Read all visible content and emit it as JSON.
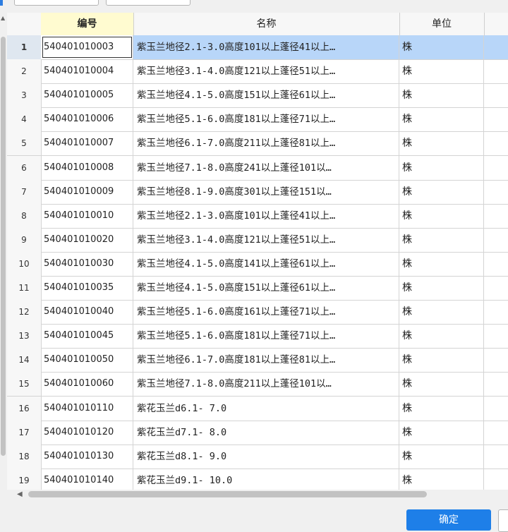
{
  "table": {
    "headers": {
      "code": "编号",
      "name": "名称",
      "unit": "单位"
    },
    "rows": [
      {
        "num": "1",
        "code": "540401010003",
        "name": "紫玉兰地径2.1-3.0高度101以上蓬径41以上…",
        "unit": "株"
      },
      {
        "num": "2",
        "code": "540401010004",
        "name": "紫玉兰地径3.1-4.0高度121以上蓬径51以上…",
        "unit": "株"
      },
      {
        "num": "3",
        "code": "540401010005",
        "name": "紫玉兰地径4.1-5.0高度151以上蓬径61以上…",
        "unit": "株"
      },
      {
        "num": "4",
        "code": "540401010006",
        "name": "紫玉兰地径5.1-6.0高度181以上蓬径71以上…",
        "unit": "株"
      },
      {
        "num": "5",
        "code": "540401010007",
        "name": "紫玉兰地径6.1-7.0高度211以上蓬径81以上…",
        "unit": "株"
      },
      {
        "num": "6",
        "code": "540401010008",
        "name": "紫玉兰地径7.1-8.0高度241以上蓬径101以…",
        "unit": "株"
      },
      {
        "num": "7",
        "code": "540401010009",
        "name": "紫玉兰地径8.1-9.0高度301以上蓬径151以…",
        "unit": "株"
      },
      {
        "num": "8",
        "code": "540401010010",
        "name": "紫玉兰地径2.1-3.0高度101以上蓬径41以上…",
        "unit": "株"
      },
      {
        "num": "9",
        "code": "540401010020",
        "name": "紫玉兰地径3.1-4.0高度121以上蓬径51以上…",
        "unit": "株"
      },
      {
        "num": "10",
        "code": "540401010030",
        "name": "紫玉兰地径4.1-5.0高度141以上蓬径61以上…",
        "unit": "株"
      },
      {
        "num": "11",
        "code": "540401010035",
        "name": "紫玉兰地径4.1-5.0高度151以上蓬径61以上…",
        "unit": "株"
      },
      {
        "num": "12",
        "code": "540401010040",
        "name": "紫玉兰地径5.1-6.0高度161以上蓬径71以上…",
        "unit": "株"
      },
      {
        "num": "13",
        "code": "540401010045",
        "name": "紫玉兰地径5.1-6.0高度181以上蓬径71以上…",
        "unit": "株"
      },
      {
        "num": "14",
        "code": "540401010050",
        "name": "紫玉兰地径6.1-7.0高度181以上蓬径81以上…",
        "unit": "株"
      },
      {
        "num": "15",
        "code": "540401010060",
        "name": "紫玉兰地径7.1-8.0高度211以上蓬径101以…",
        "unit": "株"
      },
      {
        "num": "16",
        "code": "540401010110",
        "name": "紫花玉兰d6.1- 7.0",
        "unit": "株"
      },
      {
        "num": "17",
        "code": "540401010120",
        "name": "紫花玉兰d7.1- 8.0",
        "unit": "株"
      },
      {
        "num": "18",
        "code": "540401010130",
        "name": "紫花玉兰d8.1- 9.0",
        "unit": "株"
      },
      {
        "num": "19",
        "code": "540401010140",
        "name": "紫花玉兰d9.1- 10.0",
        "unit": "株"
      }
    ],
    "selected_row": "1"
  },
  "footer": {
    "ok_label": "确定"
  },
  "colors": {
    "accent": "#1e7fe8",
    "selection": "#b8d6f9",
    "code_header": "#fffbd0"
  },
  "icons": {
    "scroll_up": "triangle-up",
    "scroll_left": "triangle-left"
  }
}
